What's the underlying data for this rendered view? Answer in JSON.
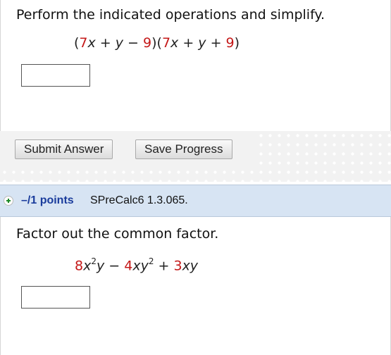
{
  "question1": {
    "prompt": "Perform the indicated operations and simplify.",
    "expr": {
      "open1": "(",
      "coef1": "7",
      "var1": "x",
      "op1": " + ",
      "var2": "y",
      "op2": " − ",
      "const1": "9",
      "close1": ")",
      "open2": "(",
      "coef2": "7",
      "var3": "x",
      "op3": " + ",
      "var4": "y",
      "op4": " + ",
      "const2": "9",
      "close2": ")"
    },
    "answer_value": ""
  },
  "buttons": {
    "submit_label": "Submit Answer",
    "save_label": "Save Progress"
  },
  "question2_header": {
    "points": "–/1 points",
    "id": "SPreCalc6 1.3.065."
  },
  "question2": {
    "prompt": "Factor out the common factor.",
    "expr": {
      "c1": "8",
      "v1": "x",
      "e1": "2",
      "v2": "y",
      "op1": " − ",
      "c2": "4",
      "v3": "x",
      "v4": "y",
      "e2": "2",
      "op2": " + ",
      "c3": "3",
      "v5": "xy"
    },
    "answer_value": ""
  },
  "colors": {
    "coefficient": "#c41818",
    "header_bg": "#d7e4f3",
    "points_text": "#1a3c9c",
    "plus_icon": "#1f8a2a"
  }
}
